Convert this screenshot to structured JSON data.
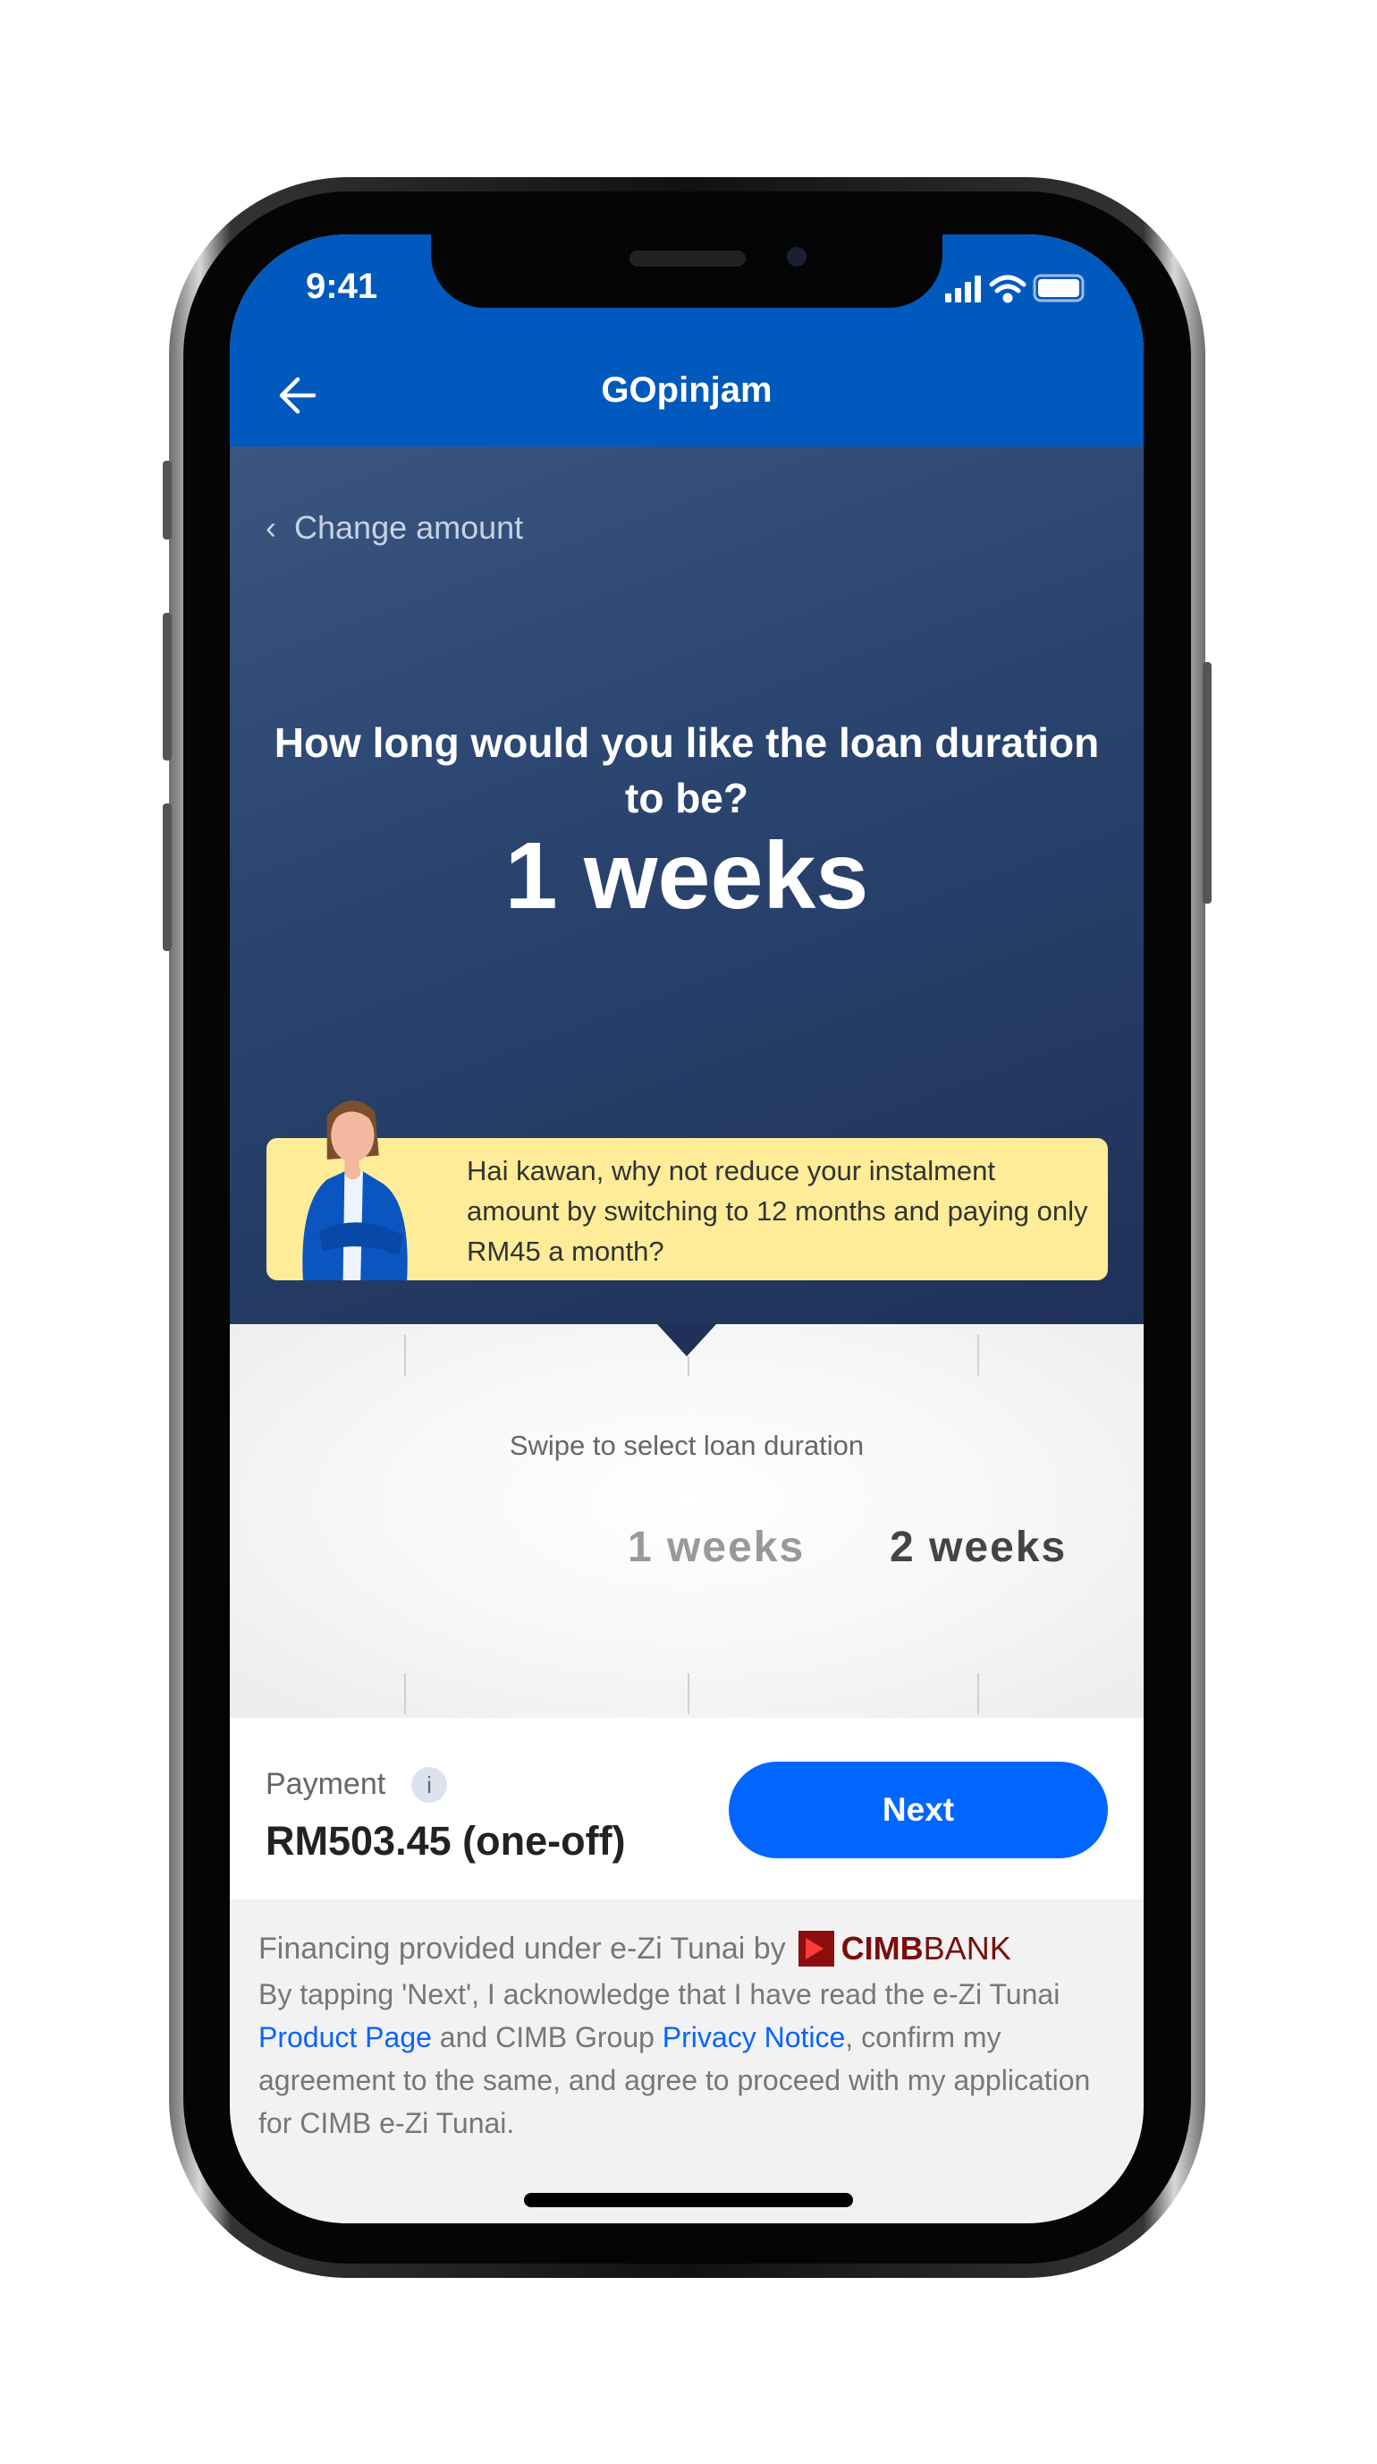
{
  "status_bar": {
    "time": "9:41"
  },
  "header": {
    "title": "GOpinjam",
    "back_icon": "arrow-left-icon"
  },
  "hero": {
    "change_amount": "Change amount",
    "question": "How long would you like the loan duration to be?",
    "selected_duration": "1 weeks"
  },
  "tip": {
    "text": "Hai kawan, why not reduce your instalment amount by switching to 12 months and paying only RM45 a month?"
  },
  "picker": {
    "hint": "Swipe to select loan duration",
    "options": [
      {
        "label": "1 weeks",
        "selected": true
      },
      {
        "label": "2 weeks",
        "selected": false
      }
    ]
  },
  "payment": {
    "label": "Payment",
    "info": "i",
    "amount": "RM503.45 (one-off)",
    "next_label": "Next"
  },
  "disclaimer": {
    "financing": "Financing provided under e-Zi Tunai by",
    "bank_logo": {
      "bold": "CIMB",
      "light": "BANK"
    },
    "p1": "By tapping 'Next', I acknowledge that I have read the e-Zi Tunai ",
    "link1": "Product Page",
    "p2": " and CIMB Group ",
    "link2": "Privacy Notice",
    "p3": ", confirm my agreement to the same, and agree to proceed with my application for CIMB e-Zi Tunai."
  },
  "colors": {
    "brand_blue": "#0059bd",
    "button_blue": "#0066ff",
    "tip_yellow": "#feec98",
    "cimb_red": "#7a0d0d"
  }
}
